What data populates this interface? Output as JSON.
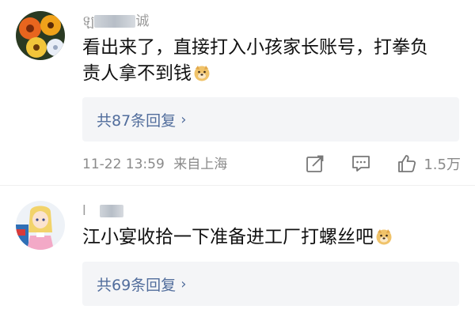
{
  "comments": [
    {
      "username_visible": "ឡ",
      "username_visible_end": "诚",
      "text_line1": "看出来了，直接打入小孩家长账号，打拳负",
      "text_line2": "责人拿不到钱",
      "emoji": "doge-emoji",
      "replies_label": "共87条回复",
      "chevron": "›",
      "timestamp": "11-22 13:59",
      "location": "来自上海",
      "like_count": "1.5万"
    },
    {
      "username_visible": "l ",
      "text_line1": "江小宴收拾一下准备进工厂打螺丝吧",
      "emoji": "doge-emoji",
      "replies_label": "共69条回复",
      "chevron": "›"
    }
  ],
  "icons": {
    "share": "share-icon",
    "comment": "comment-icon",
    "like": "thumbs-up-icon"
  },
  "colors": {
    "reply_link": "#516d9c",
    "reply_bg": "#f4f5f7",
    "meta_text": "#8a8a8a"
  }
}
